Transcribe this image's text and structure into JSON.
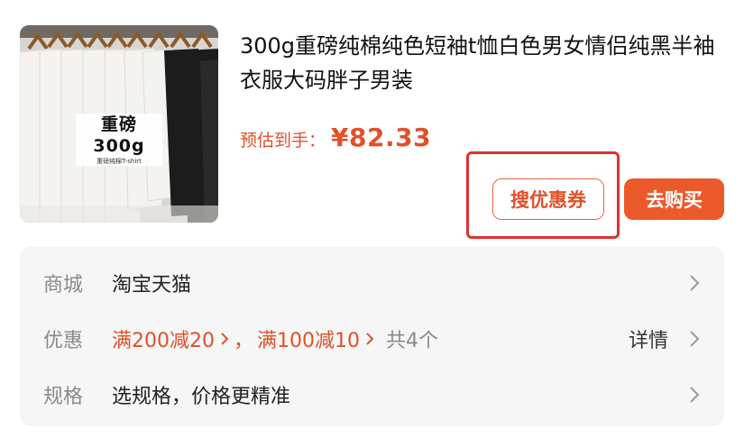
{
  "product": {
    "image_label_line1": "重磅300g",
    "image_label_line2": "重磅纯棉T-shirt",
    "title": "300g重磅纯棉纯色短袖t恤白色男女情侣纯黑半袖衣服大码胖子男装",
    "price_label": "预估到手：",
    "price_value": "¥82.33"
  },
  "actions": {
    "coupon_label": "搜优惠券",
    "buy_label": "去购买"
  },
  "info": {
    "store_label": "商城",
    "store_value": "淘宝天猫",
    "promo_label": "优惠",
    "promo_items": [
      "满200减20",
      "满100减10"
    ],
    "promo_separator": "，",
    "promo_count": "共4个",
    "promo_detail": "详情",
    "spec_label": "规格",
    "spec_value": "选规格，价格更精准"
  },
  "icons": {
    "chevron": "chevron-right-icon"
  },
  "colors": {
    "accent": "#e0512a",
    "buy_button": "#ec5a2c",
    "highlight_box": "#e03030"
  }
}
